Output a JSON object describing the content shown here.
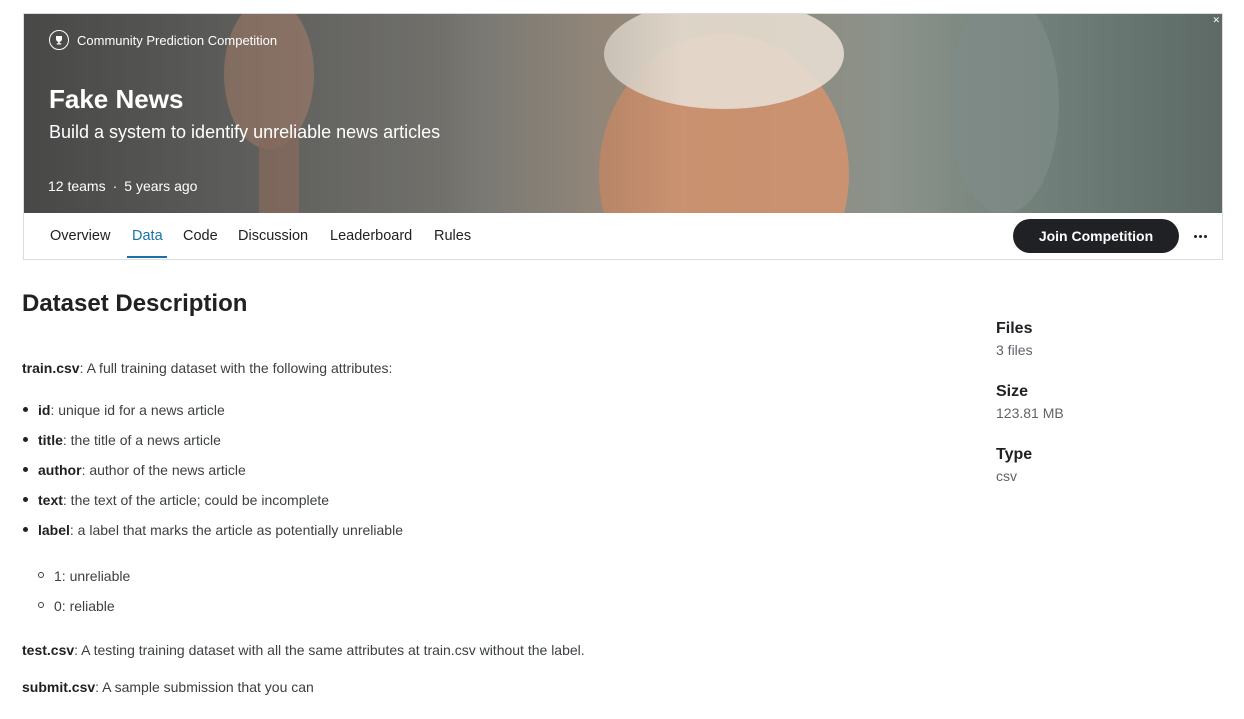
{
  "header": {
    "badge": "Community Prediction Competition",
    "title": "Fake News",
    "subtitle": "Build a system to identify unreliable news articles",
    "teams": "12 teams",
    "separator": "·",
    "age": "5 years ago"
  },
  "tabs": [
    {
      "label": "Overview"
    },
    {
      "label": "Data",
      "active": true
    },
    {
      "label": "Code"
    },
    {
      "label": "Discussion"
    },
    {
      "label": "Leaderboard"
    },
    {
      "label": "Rules"
    }
  ],
  "join_label": "Join Competition",
  "accent_color": "#1a73a8",
  "description": {
    "heading": "Dataset Description",
    "train_file": "train.csv",
    "train_text": ": A full training dataset with the following attributes:",
    "attributes": [
      {
        "name": "id",
        "desc": ": unique id for a news article"
      },
      {
        "name": "title",
        "desc": ": the title of a news article"
      },
      {
        "name": "author",
        "desc": ": author of the news article"
      },
      {
        "name": "text",
        "desc": ": the text of the article; could be incomplete"
      },
      {
        "name": "label",
        "desc": ": a label that marks the article as potentially unreliable"
      }
    ],
    "label_values": [
      "1: unreliable",
      "0: reliable"
    ],
    "test_file": "test.csv",
    "test_text": ": A testing training dataset with all the same attributes at train.csv without the label.",
    "submit_file": "submit.csv",
    "submit_text": ": A sample submission that you can"
  },
  "sidebar": {
    "files_label": "Files",
    "files_value": "3 files",
    "size_label": "Size",
    "size_value": "123.81 MB",
    "type_label": "Type",
    "type_value": "csv"
  }
}
